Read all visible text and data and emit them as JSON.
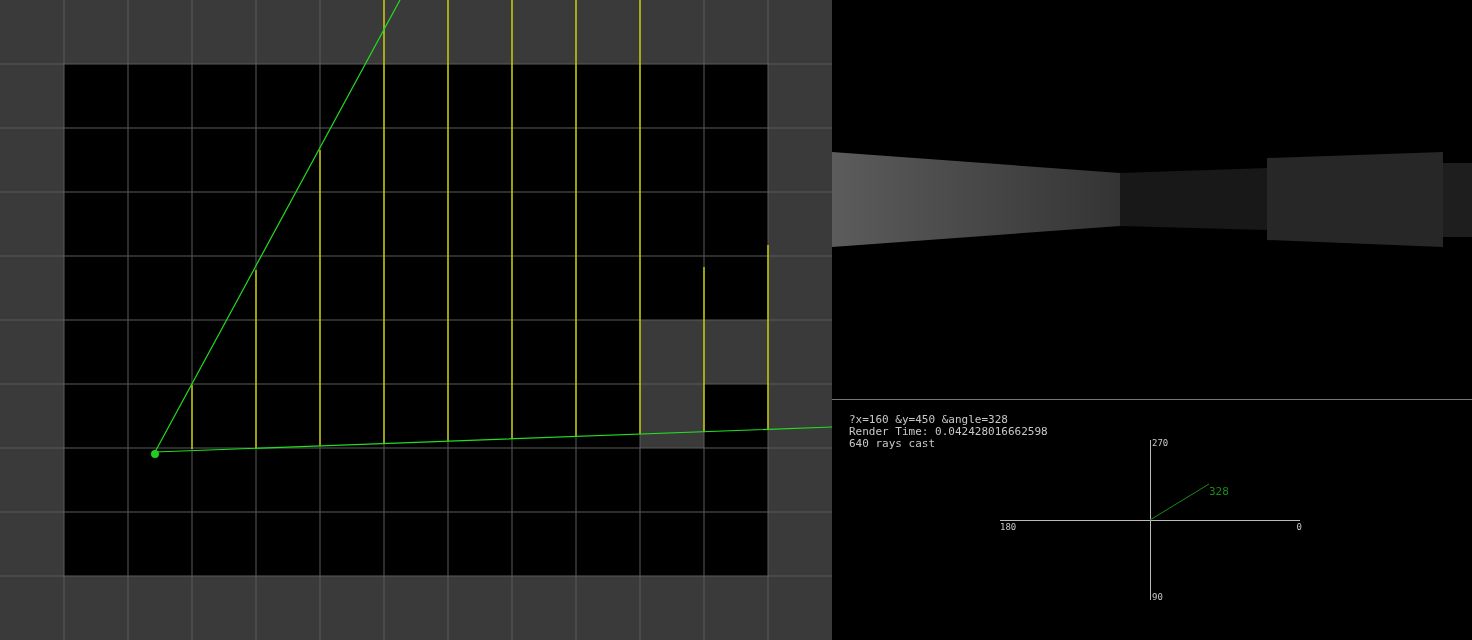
{
  "debug_info": {
    "query": "?x=160 &y=450 &angle=328",
    "render_time": "Render Time: 0.042428016662598",
    "rays": "640 rays cast"
  },
  "compass": {
    "labels": [
      {
        "kind": "top",
        "text": "270"
      },
      {
        "kind": "left",
        "text": "180"
      },
      {
        "kind": "right",
        "text": "0"
      },
      {
        "kind": "bottom",
        "text": "90"
      }
    ],
    "heading_label": "328"
  }
}
